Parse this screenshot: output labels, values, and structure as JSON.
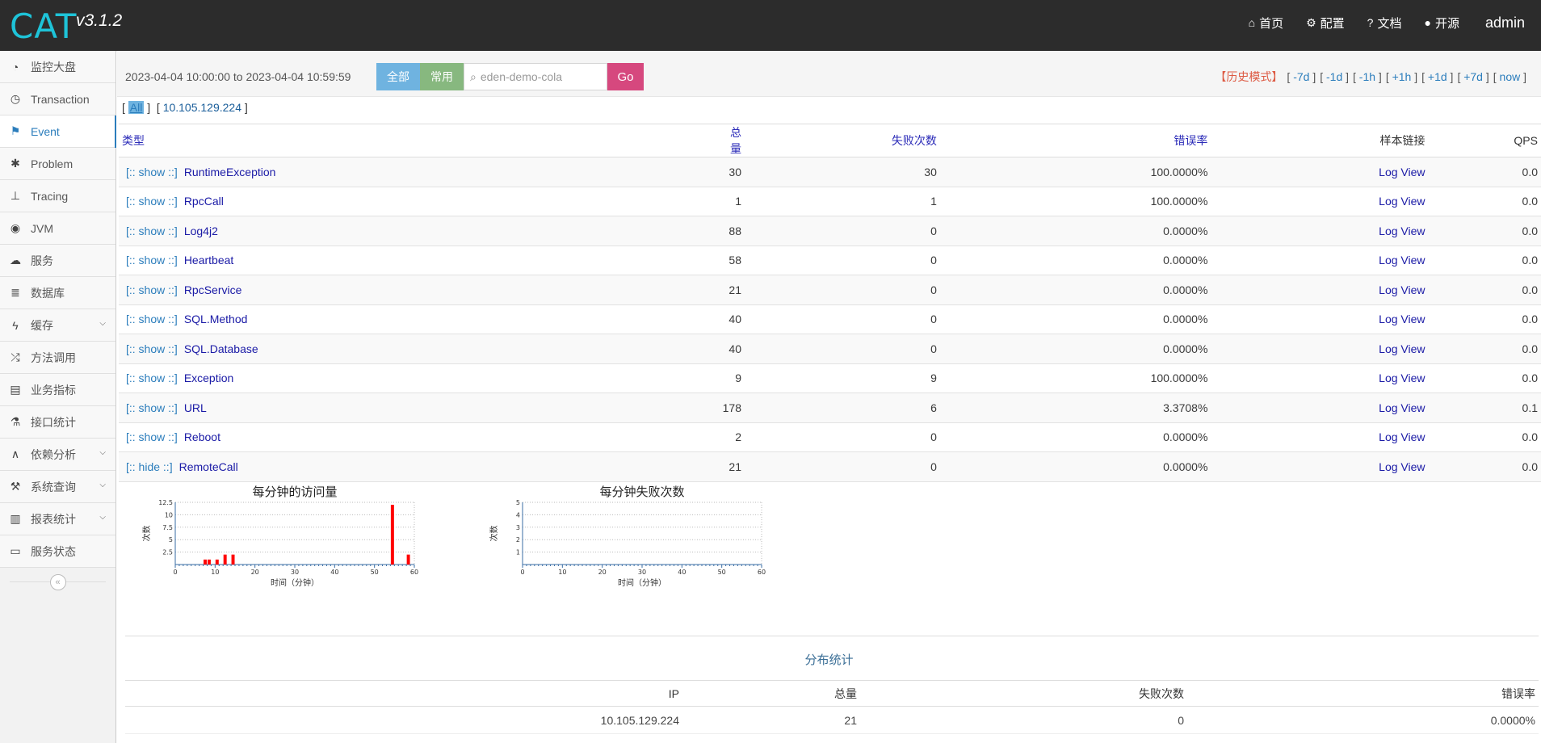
{
  "app": {
    "logo": "CAT",
    "version": "v3.1.2"
  },
  "nav": [
    {
      "icon": "home-icon",
      "glyph": "⌂",
      "label": "首页"
    },
    {
      "icon": "gears-icon",
      "glyph": "⚙",
      "label": "配置"
    },
    {
      "icon": "question-circle-icon",
      "glyph": "?",
      "label": "文档"
    },
    {
      "icon": "github-icon",
      "glyph": "●",
      "label": "开源"
    }
  ],
  "user": "admin",
  "sidebar": {
    "items": [
      {
        "label": "监控大盘",
        "icon": "dashboard-icon",
        "glyph": "◔"
      },
      {
        "label": "Transaction",
        "icon": "clock-icon",
        "glyph": "◷"
      },
      {
        "label": "Event",
        "icon": "flag-icon",
        "glyph": "⚑"
      },
      {
        "label": "Problem",
        "icon": "bug-icon",
        "glyph": "✱"
      },
      {
        "label": "Tracing",
        "icon": "sitemap-icon",
        "glyph": "⊥"
      },
      {
        "label": "JVM",
        "icon": "eye-icon",
        "glyph": "◉"
      },
      {
        "label": "服务",
        "icon": "cloud-icon",
        "glyph": "☁"
      },
      {
        "label": "数据库",
        "icon": "database-icon",
        "glyph": "≣"
      },
      {
        "label": "缓存",
        "icon": "bolt-icon",
        "glyph": "ϟ",
        "expandable": true
      },
      {
        "label": "方法调用",
        "icon": "random-icon",
        "glyph": "⤮"
      },
      {
        "label": "业务指标",
        "icon": "list-alt-icon",
        "glyph": "▤"
      },
      {
        "label": "接口统计",
        "icon": "flask-icon",
        "glyph": "⚗"
      },
      {
        "label": "依赖分析",
        "icon": "road-icon",
        "glyph": "∧",
        "expandable": true
      },
      {
        "label": "系统查询",
        "icon": "gavel-icon",
        "glyph": "⚒",
        "expandable": true
      },
      {
        "label": "报表统计",
        "icon": "bar-chart-icon",
        "glyph": "▥",
        "expandable": true
      },
      {
        "label": "服务状态",
        "icon": "desktop-icon",
        "glyph": "▭"
      }
    ],
    "active": "Event",
    "collapse_glyph": "«"
  },
  "toolbar": {
    "range": "2023-04-04 10:00:00 to 2023-04-04 10:59:59",
    "btn_all": "全部",
    "btn_common": "常用",
    "search_value": "eden-demo-cola",
    "go": "Go",
    "history_mode": "【历史模式】",
    "history_links": [
      "-7d",
      "-1d",
      "-1h",
      "+1h",
      "+1d",
      "+7d",
      "now"
    ]
  },
  "ip_filter": {
    "all": "All",
    "ip": "10.105.129.224"
  },
  "table": {
    "headers": {
      "type": "类型",
      "total": "总量",
      "fail": "失败次数",
      "error_rate": "错误率",
      "sample": "样本链接",
      "qps": "QPS"
    },
    "rows": [
      {
        "show": "[:: show ::]",
        "type": "RuntimeException",
        "total": "30",
        "fail": "30",
        "rate": "100.0000%",
        "link": "Log View",
        "qps": "0.0"
      },
      {
        "show": "[:: show ::]",
        "type": "RpcCall",
        "total": "1",
        "fail": "1",
        "rate": "100.0000%",
        "link": "Log View",
        "qps": "0.0"
      },
      {
        "show": "[:: show ::]",
        "type": "Log4j2",
        "total": "88",
        "fail": "0",
        "rate": "0.0000%",
        "link": "Log View",
        "qps": "0.0"
      },
      {
        "show": "[:: show ::]",
        "type": "Heartbeat",
        "total": "58",
        "fail": "0",
        "rate": "0.0000%",
        "link": "Log View",
        "qps": "0.0"
      },
      {
        "show": "[:: show ::]",
        "type": "RpcService",
        "total": "21",
        "fail": "0",
        "rate": "0.0000%",
        "link": "Log View",
        "qps": "0.0"
      },
      {
        "show": "[:: show ::]",
        "type": "SQL.Method",
        "total": "40",
        "fail": "0",
        "rate": "0.0000%",
        "link": "Log View",
        "qps": "0.0"
      },
      {
        "show": "[:: show ::]",
        "type": "SQL.Database",
        "total": "40",
        "fail": "0",
        "rate": "0.0000%",
        "link": "Log View",
        "qps": "0.0"
      },
      {
        "show": "[:: show ::]",
        "type": "Exception",
        "total": "9",
        "fail": "9",
        "rate": "100.0000%",
        "link": "Log View",
        "qps": "0.0"
      },
      {
        "show": "[:: show ::]",
        "type": "URL",
        "total": "178",
        "fail": "6",
        "rate": "3.3708%",
        "link": "Log View",
        "qps": "0.1"
      },
      {
        "show": "[:: show ::]",
        "type": "Reboot",
        "total": "2",
        "fail": "0",
        "rate": "0.0000%",
        "link": "Log View",
        "qps": "0.0"
      },
      {
        "show": "[:: hide ::]",
        "type": "RemoteCall",
        "total": "21",
        "fail": "0",
        "rate": "0.0000%",
        "link": "Log View",
        "qps": "0.0"
      }
    ]
  },
  "chart_data": [
    {
      "type": "bar",
      "title": "每分钟的访问量",
      "xlabel": "时间（分钟）",
      "ylabel": "次数",
      "xlim": [
        0,
        60
      ],
      "ylim": [
        0,
        12.5
      ],
      "xticks": [
        "0",
        "10",
        "20",
        "30",
        "40",
        "50",
        "60"
      ],
      "yticks": [
        "2.5",
        "5",
        "7.5",
        "10",
        "12.5"
      ],
      "x": [
        7,
        8,
        10,
        12,
        14,
        54,
        58
      ],
      "values": [
        1,
        1,
        1,
        2,
        2,
        12,
        2
      ],
      "color": "#ff0000"
    },
    {
      "type": "bar",
      "title": "每分钟失败次数",
      "xlabel": "时间（分钟）",
      "ylabel": "次数",
      "xlim": [
        0,
        60
      ],
      "ylim": [
        0,
        5
      ],
      "xticks": [
        "0",
        "10",
        "20",
        "30",
        "40",
        "50",
        "60"
      ],
      "yticks": [
        "1",
        "2",
        "3",
        "4",
        "5"
      ],
      "x": [],
      "values": [],
      "color": "#ff0000"
    }
  ],
  "distribution": {
    "title": "分布统计",
    "headers": {
      "ip": "IP",
      "total": "总量",
      "fail": "失败次数",
      "rate": "错误率"
    },
    "rows": [
      {
        "ip": "10.105.129.224",
        "total": "21",
        "fail": "0",
        "rate": "0.0000%"
      }
    ]
  }
}
